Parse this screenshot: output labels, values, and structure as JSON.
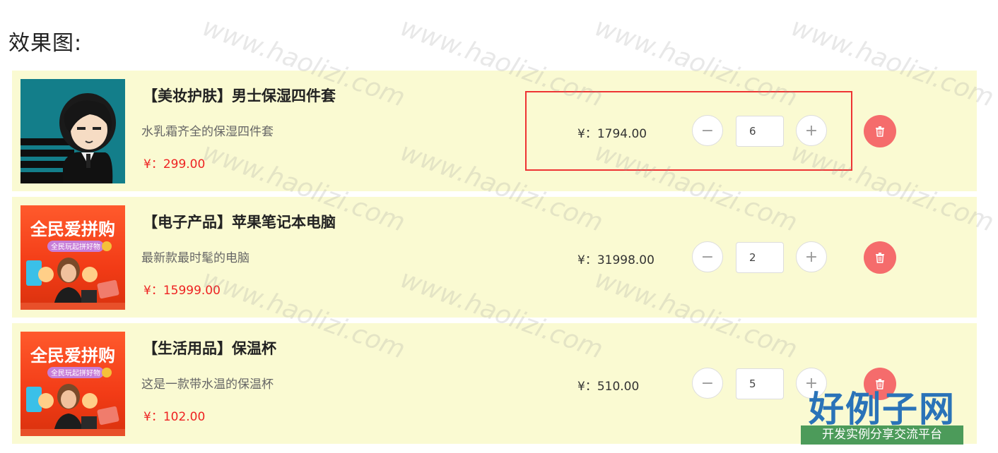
{
  "page": {
    "title": "效果图:"
  },
  "cart": {
    "items": [
      {
        "name": "【美妆护肤】男士保湿四件套",
        "description": "水乳霜齐全的保湿四件套",
        "unit_price": "¥：299.00",
        "subtotal": "¥：1794.00",
        "quantity": "6",
        "thumbnail": "cartoon-man-icon"
      },
      {
        "name": "【电子产品】苹果笔记本电脑",
        "description": "最新款最时髦的电脑",
        "unit_price": "¥：15999.00",
        "subtotal": "¥：31998.00",
        "quantity": "2",
        "thumbnail": "group-buy-promo-banner",
        "promo_headline": "全民爱拼购",
        "promo_tagline": "全民玩起拼好物"
      },
      {
        "name": "【生活用品】保温杯",
        "description": "这是一款带水温的保温杯",
        "unit_price": "¥：102.00",
        "subtotal": "¥：510.00",
        "quantity": "5",
        "thumbnail": "group-buy-promo-banner",
        "promo_headline": "全民爱拼购",
        "promo_tagline": "全民玩起拼好物"
      }
    ],
    "controls": {
      "minus_symbol": "−",
      "plus_symbol": "+",
      "delete_icon": "trash-icon"
    }
  },
  "watermark": {
    "text": "www.haolizi.com"
  },
  "brand": {
    "name": "好例子网",
    "slogan": "开发实例分享交流平台"
  },
  "colors": {
    "row_background": "#fafad2",
    "price_red": "#ee2222",
    "delete_red": "#f56c6c",
    "highlight_border": "#e33333",
    "brand_blue": "#2a73b8",
    "brand_green": "#4c9b5a"
  }
}
